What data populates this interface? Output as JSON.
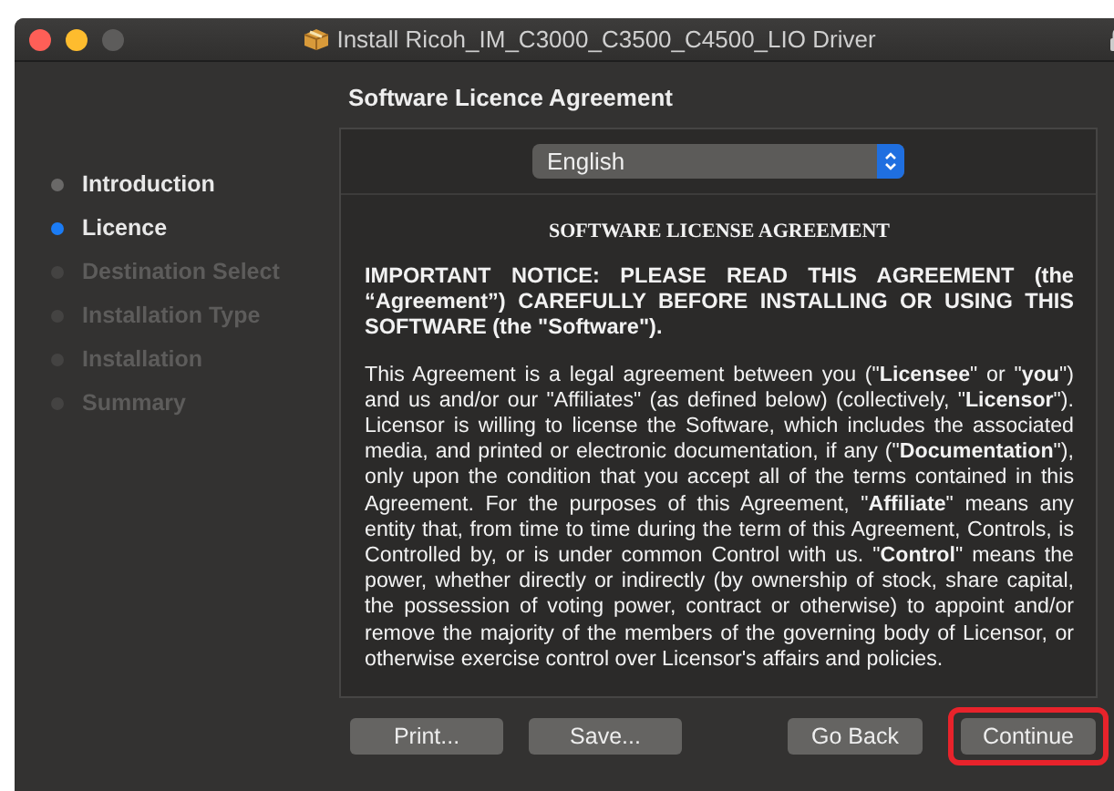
{
  "window": {
    "title": "Install Ricoh_IM_C3000_C3500_C4500_LIO Driver"
  },
  "sidebar": {
    "steps": [
      {
        "label": "Introduction",
        "selected": false,
        "disabled": false
      },
      {
        "label": "Licence",
        "selected": true,
        "disabled": false
      },
      {
        "label": "Destination Select",
        "selected": false,
        "disabled": true
      },
      {
        "label": "Installation Type",
        "selected": false,
        "disabled": true
      },
      {
        "label": "Installation",
        "selected": false,
        "disabled": true
      },
      {
        "label": "Summary",
        "selected": false,
        "disabled": true
      }
    ]
  },
  "heading": "Software Licence Agreement",
  "language_popup": {
    "value": "English"
  },
  "document": {
    "title": "SOFTWARE LICENSE AGREEMENT",
    "paragraphs": [
      "IMPORTANT NOTICE: PLEASE READ THIS AGREEMENT (the “Agreement”) CAREFULLY BEFORE INSTALLING OR USING THIS SOFTWARE (the \"Software\").",
      "This Agreement is a legal agreement between you (\"**Licensee**\" or \"**you**\") and us and/or our \"Affiliates\" (as defined below) (collectively, \"**Licensor**\"). Licensor is willing to license the Software, which includes the associated media, and printed or electronic documentation, if any (\"**Documentation**\"), only upon the condition that you accept all of the terms contained in this Agreement.  For the purposes of this Agreement, \"**Affiliate**\" means any entity that, from time to time during the term of this Agreement, Controls, is Controlled by, or is under common Control with us. \"**Control**\" means the power, whether directly or indirectly (by ownership of stock, share capital, the possession of voting power, contract or otherwise) to appoint and/or remove the majority of the members of the governing body of Licensor, or otherwise exercise control over Licensor's affairs and policies."
    ]
  },
  "buttons": [
    {
      "label": "Print...",
      "highlighted": false
    },
    {
      "label": "Save...",
      "highlighted": false
    },
    {
      "label": "Go Back",
      "highlighted": false
    },
    {
      "label": "Continue",
      "highlighted": true
    }
  ]
}
